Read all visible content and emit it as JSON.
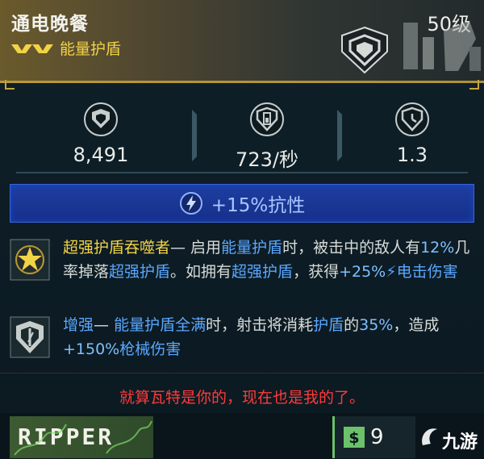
{
  "item": {
    "name": "通电晚餐",
    "level": "50级",
    "type": "能量护盾"
  },
  "stats": [
    {
      "icon": "shield-capacity-icon",
      "value": "8,491"
    },
    {
      "icon": "shield-recharge-rate-icon",
      "value": "723/秒"
    },
    {
      "icon": "shield-recharge-delay-icon",
      "value": "1.3"
    }
  ],
  "resist": {
    "icon": "lightning-icon",
    "text": "+15%抗性"
  },
  "perks": [
    {
      "icon": "star-perk-icon",
      "segments": [
        {
          "t": "超强护盾吞噬者",
          "c": "gold"
        },
        {
          "t": "— 启用",
          "c": ""
        },
        {
          "t": "能量护盾",
          "c": "blue"
        },
        {
          "t": "时，被击中的敌人有",
          "c": ""
        },
        {
          "t": "12%",
          "c": "lt"
        },
        {
          "t": "几率掉落",
          "c": ""
        },
        {
          "t": "超强护盾",
          "c": "blue"
        },
        {
          "t": "。如拥有",
          "c": ""
        },
        {
          "t": "超强护盾",
          "c": "blue"
        },
        {
          "t": "，获得",
          "c": ""
        },
        {
          "t": "+25%",
          "c": "lt"
        },
        {
          "t": "⚡",
          "c": "blue"
        },
        {
          "t": "电击伤害",
          "c": "blue"
        }
      ]
    },
    {
      "icon": "augment-perk-icon",
      "segments": [
        {
          "t": "增强",
          "c": "blue"
        },
        {
          "t": "— ",
          "c": ""
        },
        {
          "t": "能量护盾全满",
          "c": "blue"
        },
        {
          "t": "时，射击将消耗",
          "c": ""
        },
        {
          "t": "护盾",
          "c": "blue"
        },
        {
          "t": "的",
          "c": ""
        },
        {
          "t": "35%",
          "c": "lt"
        },
        {
          "t": "，造成",
          "c": ""
        },
        {
          "t": "+150%",
          "c": "lt"
        },
        {
          "t": "枪械伤害",
          "c": "blue"
        }
      ]
    }
  ],
  "flavor_text": "就算瓦特是你的，现在也是我的了。",
  "footer": {
    "manufacturer": "RIPPER",
    "price_symbol": "$",
    "price": "9",
    "watermark": "九游"
  },
  "colors": {
    "rarity_gold": "#f1d347",
    "element_blue": "#5aa7ff",
    "flavor_red": "#ff3b3b",
    "resist_bar": "#1f3ea0"
  }
}
